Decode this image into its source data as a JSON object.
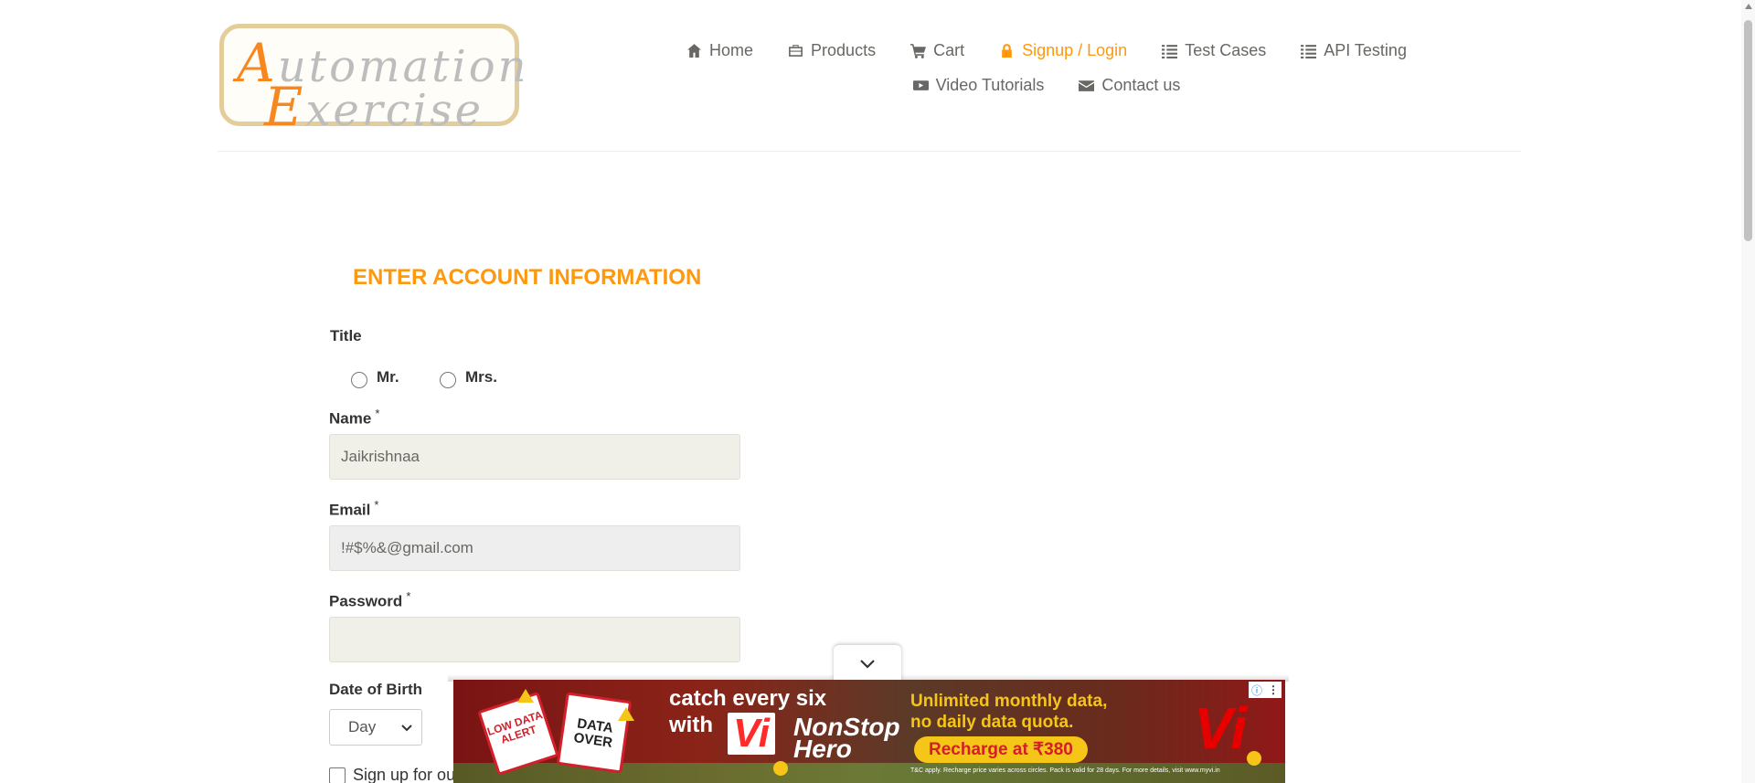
{
  "logo": {
    "line1_cap": "A",
    "line1_rest": "utomation",
    "line2_cap": "E",
    "line2_rest": "xercise"
  },
  "nav": {
    "items": [
      {
        "label": "Home",
        "icon": "home-icon",
        "active": false
      },
      {
        "label": "Products",
        "icon": "briefcase-icon",
        "active": false
      },
      {
        "label": "Cart",
        "icon": "cart-icon",
        "active": false
      },
      {
        "label": "Signup / Login",
        "icon": "lock-icon",
        "active": true
      },
      {
        "label": "Test Cases",
        "icon": "list-icon",
        "active": false
      },
      {
        "label": "API Testing",
        "icon": "list-icon",
        "active": false
      },
      {
        "label": "Video Tutorials",
        "icon": "youtube-icon",
        "active": false
      },
      {
        "label": "Contact us",
        "icon": "envelope-icon",
        "active": false
      }
    ],
    "active_color": "#fe980f"
  },
  "form": {
    "heading": "ENTER ACCOUNT INFORMATION",
    "title_label": "Title",
    "title_options": [
      "Mr.",
      "Mrs."
    ],
    "name_label": "Name",
    "name_value": "Jaikrishnaa",
    "email_label": "Email",
    "email_value": "!#$%&@gmail.com",
    "password_label": "Password",
    "password_value": "",
    "dob_label": "Date of Birth",
    "dob_day": "Day",
    "newsletter_label": "Sign up for our",
    "required_mark": "*"
  },
  "ad": {
    "headline_line1": "catch every six",
    "headline_line2": "with",
    "brand": "Vi",
    "product_line1": "NonStop",
    "product_line2": "Hero",
    "offer_line1": "Unlimited monthly data,",
    "offer_line2": "no daily data quota.",
    "cta": "Recharge at ₹380",
    "card1": "LOW DATA ALERT",
    "card2_line1": "DATA",
    "card2_line2": "OVER",
    "fine_print": "T&C apply. Recharge price varies across circles. Pack is valid for 28 days. For more details, visit www.myvi.in",
    "info_icon": "info-icon",
    "menu_icon": "more-vertical-icon"
  }
}
